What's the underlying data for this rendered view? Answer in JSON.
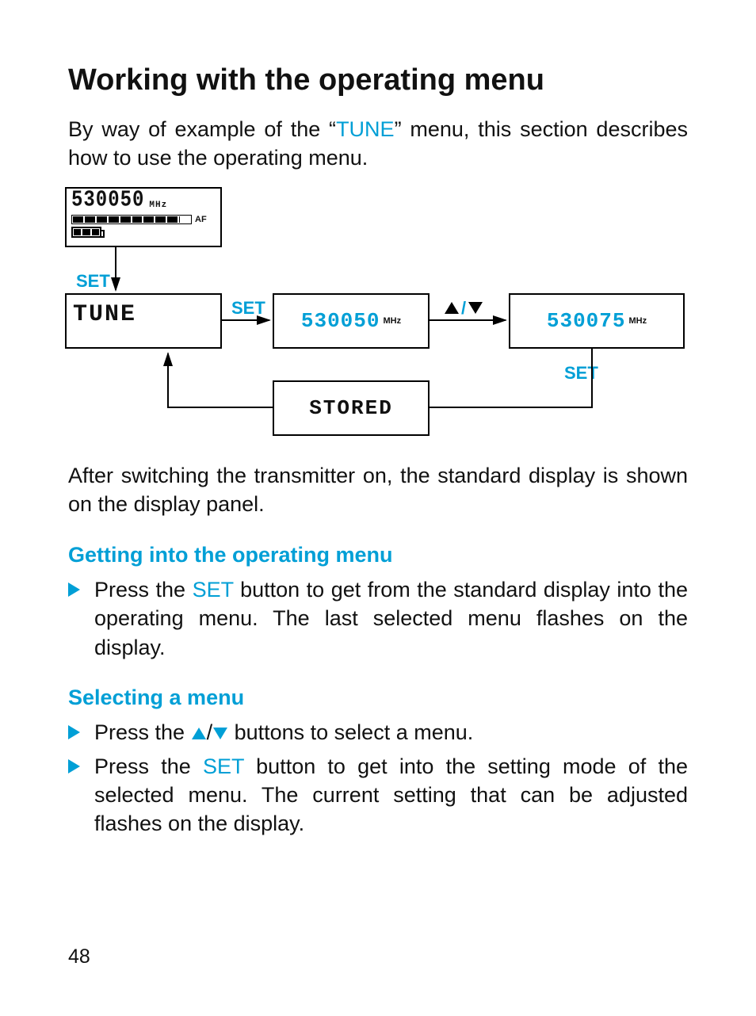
{
  "page_number": "48",
  "title": "Working with the operating menu",
  "intro": {
    "pre": "By way of example of the “",
    "tune": "TUNE",
    "post": "” menu, this section describes how to use the operating menu."
  },
  "diagram": {
    "top_freq": "530050",
    "mhz": "MHz",
    "af": "AF",
    "tune_label": "TUNE",
    "freq_a": "530050",
    "freq_b": "530075",
    "stored": "STORED",
    "set": "SET"
  },
  "after_text": "After switching the transmitter on, the standard display is shown on the display panel.",
  "sec1": {
    "title": "Getting into the operating menu",
    "step1_pre": "Press the ",
    "step1_set": "SET",
    "step1_post": " button to get from the standard display into the operating menu. The last selected menu flashes on the display."
  },
  "sec2": {
    "title": "Selecting a menu",
    "step1_pre": "Press the ",
    "step1_post": " buttons to select a menu.",
    "step2_pre": "Press the ",
    "step2_set": "SET",
    "step2_post": " button to get into the setting mode of the selected menu. The current setting that can be adjusted flashes on the display."
  }
}
